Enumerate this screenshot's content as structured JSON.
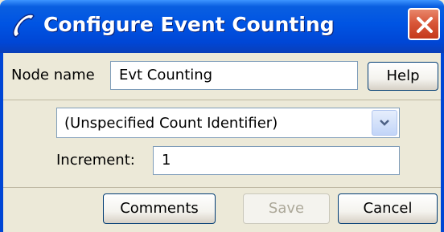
{
  "window": {
    "title": "Configure Event Counting",
    "title_icon": "phone-handset-icon",
    "close_icon": "close-icon",
    "colors": {
      "titlebar": "#0054e3",
      "close": "#d9583a",
      "face": "#ece9d8"
    }
  },
  "node": {
    "label": "Node name",
    "value": "Evt Counting",
    "help_label": "Help"
  },
  "counter": {
    "selected": "(Unspecified Count Identifier)",
    "dropdown_icon": "chevron-down-icon",
    "increment_label": "Increment:",
    "increment_value": "1"
  },
  "actions": {
    "comments_label": "Comments",
    "save_label": "Save",
    "save_enabled": false,
    "cancel_label": "Cancel"
  }
}
